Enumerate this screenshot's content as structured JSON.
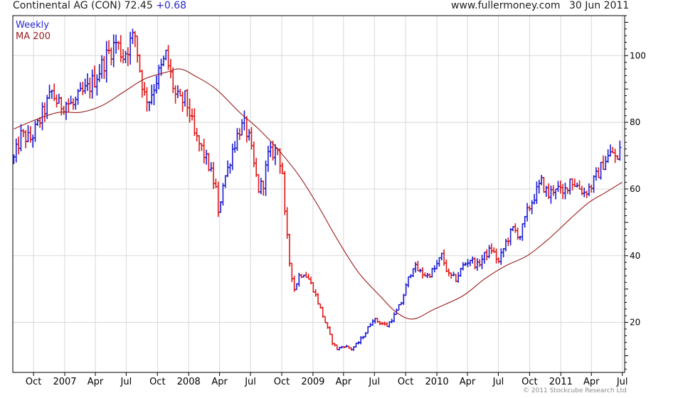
{
  "header": {
    "title": "Continental AG (CON)",
    "price": "72.45",
    "change": "+0.68",
    "site": "www.fullermoney.com",
    "date": "30 Jun 2011"
  },
  "legend": {
    "weekly_label": "Weekly",
    "ma_label": "MA 200"
  },
  "copyright": "© 2011 Stockcube Research Ltd",
  "colors": {
    "up": "#1c1cd6",
    "down": "#e01818",
    "ma": "#9b1c1c",
    "grid": "#d8d8d8",
    "axis": "#000000",
    "weekly_text": "#2a2acc",
    "ma_text": "#9b1c1c"
  },
  "chart_data": {
    "type": "ohlc",
    "interval": "weekly",
    "ylim": [
      5,
      112
    ],
    "yticks": [
      20,
      40,
      60,
      80,
      100
    ],
    "x_start": "2006-08-01",
    "x_end": "2011-07-08",
    "xticks": [
      {
        "label": "Oct",
        "date": "2006-10-01"
      },
      {
        "label": "2007",
        "date": "2007-01-01"
      },
      {
        "label": "Apr",
        "date": "2007-04-01"
      },
      {
        "label": "Jul",
        "date": "2007-07-01"
      },
      {
        "label": "Oct",
        "date": "2007-10-01"
      },
      {
        "label": "2008",
        "date": "2008-01-01"
      },
      {
        "label": "Apr",
        "date": "2008-04-01"
      },
      {
        "label": "Jul",
        "date": "2008-07-01"
      },
      {
        "label": "Oct",
        "date": "2008-10-01"
      },
      {
        "label": "2009",
        "date": "2009-01-01"
      },
      {
        "label": "Apr",
        "date": "2009-04-01"
      },
      {
        "label": "Jul",
        "date": "2009-07-01"
      },
      {
        "label": "Oct",
        "date": "2009-10-01"
      },
      {
        "label": "2010",
        "date": "2010-01-01"
      },
      {
        "label": "Apr",
        "date": "2010-04-01"
      },
      {
        "label": "Jul",
        "date": "2010-07-01"
      },
      {
        "label": "Oct",
        "date": "2010-10-01"
      },
      {
        "label": "2011",
        "date": "2011-01-01"
      },
      {
        "label": "Apr",
        "date": "2011-04-01"
      },
      {
        "label": "Jul",
        "date": "2011-07-01"
      }
    ],
    "price_path": [
      [
        "2006-08-04",
        69
      ],
      [
        "2006-08-25",
        76
      ],
      [
        "2006-09-22",
        75
      ],
      [
        "2006-10-13",
        79
      ],
      [
        "2006-11-03",
        84
      ],
      [
        "2006-11-24",
        89
      ],
      [
        "2006-12-15",
        85
      ],
      [
        "2007-01-05",
        86
      ],
      [
        "2007-01-26",
        85
      ],
      [
        "2007-02-16",
        88
      ],
      [
        "2007-03-09",
        90
      ],
      [
        "2007-03-30",
        93
      ],
      [
        "2007-04-20",
        97
      ],
      [
        "2007-05-11",
        101
      ],
      [
        "2007-06-01",
        104
      ],
      [
        "2007-06-22",
        100
      ],
      [
        "2007-07-13",
        104
      ],
      [
        "2007-07-27",
        106
      ],
      [
        "2007-08-10",
        96
      ],
      [
        "2007-08-24",
        88
      ],
      [
        "2007-09-07",
        87
      ],
      [
        "2007-09-28",
        93
      ],
      [
        "2007-10-12",
        96
      ],
      [
        "2007-10-26",
        100
      ],
      [
        "2007-11-09",
        94
      ],
      [
        "2007-11-23",
        88
      ],
      [
        "2007-12-07",
        86
      ],
      [
        "2007-12-21",
        87
      ],
      [
        "2008-01-04",
        83
      ],
      [
        "2008-01-18",
        76
      ],
      [
        "2008-02-08",
        72
      ],
      [
        "2008-02-29",
        67
      ],
      [
        "2008-03-21",
        60
      ],
      [
        "2008-03-28",
        52
      ],
      [
        "2008-04-11",
        62
      ],
      [
        "2008-04-25",
        66
      ],
      [
        "2008-05-09",
        72
      ],
      [
        "2008-05-30",
        78
      ],
      [
        "2008-06-13",
        79
      ],
      [
        "2008-06-27",
        75
      ],
      [
        "2008-07-11",
        67
      ],
      [
        "2008-07-25",
        60
      ],
      [
        "2008-08-08",
        62
      ],
      [
        "2008-08-22",
        70
      ],
      [
        "2008-09-05",
        71
      ],
      [
        "2008-09-19",
        72
      ],
      [
        "2008-10-03",
        65
      ],
      [
        "2008-10-10",
        52
      ],
      [
        "2008-10-24",
        38
      ],
      [
        "2008-11-07",
        30
      ],
      [
        "2008-11-21",
        34
      ],
      [
        "2008-12-05",
        35
      ],
      [
        "2008-12-19",
        33
      ],
      [
        "2009-01-02",
        30
      ],
      [
        "2009-01-16",
        26
      ],
      [
        "2009-02-06",
        20
      ],
      [
        "2009-02-27",
        14
      ],
      [
        "2009-03-13",
        12
      ],
      [
        "2009-04-03",
        13
      ],
      [
        "2009-04-24",
        12
      ],
      [
        "2009-05-15",
        14
      ],
      [
        "2009-06-05",
        17
      ],
      [
        "2009-06-26",
        21
      ],
      [
        "2009-07-17",
        20
      ],
      [
        "2009-08-07",
        19
      ],
      [
        "2009-08-28",
        22
      ],
      [
        "2009-09-18",
        26
      ],
      [
        "2009-10-09",
        33
      ],
      [
        "2009-10-23",
        37
      ],
      [
        "2009-11-13",
        35
      ],
      [
        "2009-12-04",
        34
      ],
      [
        "2009-12-25",
        36
      ],
      [
        "2010-01-15",
        40
      ],
      [
        "2010-02-05",
        34
      ],
      [
        "2010-02-26",
        33
      ],
      [
        "2010-03-19",
        37
      ],
      [
        "2010-04-09",
        39
      ],
      [
        "2010-04-30",
        37
      ],
      [
        "2010-05-21",
        40
      ],
      [
        "2010-06-11",
        42
      ],
      [
        "2010-07-02",
        38
      ],
      [
        "2010-07-23",
        44
      ],
      [
        "2010-08-13",
        48
      ],
      [
        "2010-09-03",
        46
      ],
      [
        "2010-09-24",
        53
      ],
      [
        "2010-10-15",
        58
      ],
      [
        "2010-11-05",
        62
      ],
      [
        "2010-11-26",
        58
      ],
      [
        "2010-12-17",
        61
      ],
      [
        "2011-01-07",
        58
      ],
      [
        "2011-01-28",
        63
      ],
      [
        "2011-02-18",
        61
      ],
      [
        "2011-03-11",
        59
      ],
      [
        "2011-04-01",
        61
      ],
      [
        "2011-04-22",
        65
      ],
      [
        "2011-05-13",
        69
      ],
      [
        "2011-06-03",
        71
      ],
      [
        "2011-06-17",
        68
      ],
      [
        "2011-06-30",
        72.45
      ]
    ],
    "ma_200": [
      [
        "2006-08-04",
        78
      ],
      [
        "2006-10-13",
        81
      ],
      [
        "2006-12-15",
        83
      ],
      [
        "2007-02-16",
        83
      ],
      [
        "2007-04-20",
        85
      ],
      [
        "2007-06-22",
        89
      ],
      [
        "2007-08-24",
        93
      ],
      [
        "2007-10-26",
        95
      ],
      [
        "2007-12-07",
        96
      ],
      [
        "2008-01-18",
        94
      ],
      [
        "2008-03-21",
        90
      ],
      [
        "2008-05-30",
        83
      ],
      [
        "2008-07-25",
        78
      ],
      [
        "2008-09-19",
        72
      ],
      [
        "2008-11-21",
        64
      ],
      [
        "2009-01-16",
        55
      ],
      [
        "2009-03-13",
        45
      ],
      [
        "2009-05-15",
        35
      ],
      [
        "2009-07-17",
        28
      ],
      [
        "2009-09-04",
        23
      ],
      [
        "2009-10-23",
        21
      ],
      [
        "2009-12-25",
        24
      ],
      [
        "2010-03-19",
        28
      ],
      [
        "2010-05-21",
        33
      ],
      [
        "2010-07-23",
        37
      ],
      [
        "2010-09-24",
        40
      ],
      [
        "2010-11-26",
        45
      ],
      [
        "2011-01-28",
        51
      ],
      [
        "2011-03-25",
        56
      ],
      [
        "2011-05-13",
        59
      ],
      [
        "2011-06-30",
        62
      ]
    ]
  }
}
